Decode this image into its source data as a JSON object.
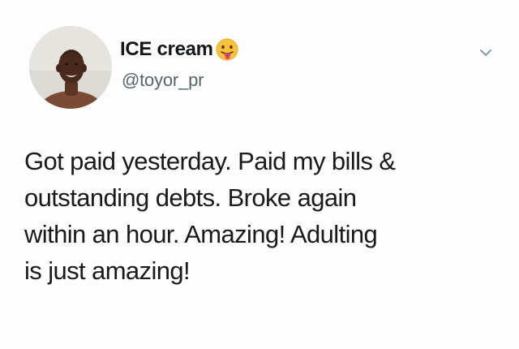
{
  "tweet": {
    "display_name": "ICE cream",
    "handle": "@toyor_pr",
    "name_emoji": "face-with-tongue-emoji",
    "menu_icon": "chevron-down-icon",
    "text_lines": [
      "Got paid yesterday. Paid my bills &",
      "outstanding debts. Broke again",
      "within an hour. Amazing! Adulting",
      "is just amazing!"
    ]
  },
  "colors": {
    "name": "#14171a",
    "handle": "#536471",
    "body_text": "#1a1a1a",
    "emoji_face": "#f7c33c",
    "emoji_tongue": "#e0456b"
  }
}
